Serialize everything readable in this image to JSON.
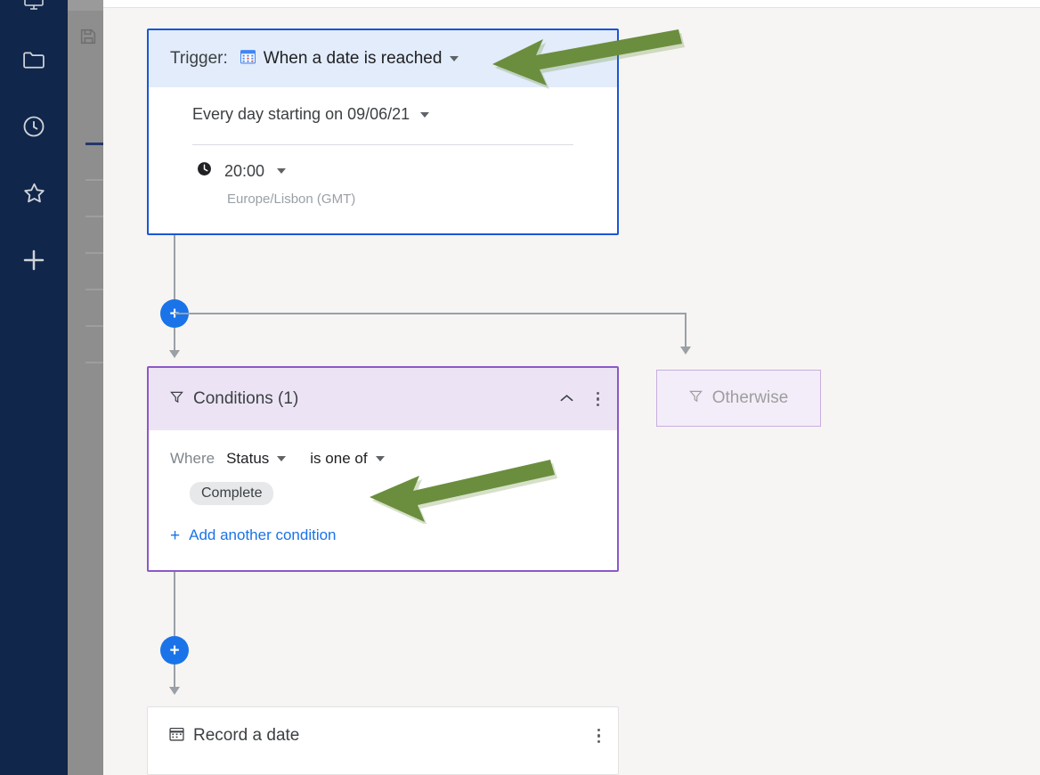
{
  "app": {
    "background_color": "#f6f5f3",
    "rail_color": "#10264a",
    "accent_blue": "#1a73e8",
    "annotation_color": "#6b8e3e"
  },
  "sidebar": {
    "items": [
      {
        "icon": "monitor-icon",
        "label": "Monitor"
      },
      {
        "icon": "folder-icon",
        "label": "Folder"
      },
      {
        "icon": "clock-icon",
        "label": "Recent"
      },
      {
        "icon": "star-icon",
        "label": "Favorites"
      },
      {
        "icon": "plus-icon",
        "label": "Add"
      }
    ]
  },
  "overlay_strip": {
    "save_icon": "save-icon",
    "row_count": 7
  },
  "trigger_card": {
    "label": "Trigger:",
    "icon": "calendar-grid-icon",
    "value": "When a date is reached",
    "caret_icon": "chevron-down-icon",
    "recurrence": "Every day starting on 09/06/21",
    "recurrence_caret_icon": "chevron-down-icon",
    "time_icon": "clock-icon",
    "time": "20:00",
    "time_caret_icon": "chevron-down-icon",
    "timezone": "Europe/Lisbon (GMT)",
    "border_color": "#1a56d6",
    "header_color": "#e2ecfa"
  },
  "conditions_card": {
    "filter_icon": "filter-icon",
    "title": "Conditions (1)",
    "collapse_icon": "chevron-up-icon",
    "menu_icon": "kebab-menu-icon",
    "where_label": "Where",
    "field": "Status",
    "field_caret_icon": "chevron-down-icon",
    "operator": "is one of",
    "operator_caret_icon": "chevron-down-icon",
    "values": [
      "Complete"
    ],
    "add_condition_label": "Add another condition",
    "add_condition_icon": "plus-icon",
    "border_color": "#8b59c6",
    "header_color": "#ece4f5"
  },
  "otherwise_box": {
    "icon": "filter-icon",
    "label": "Otherwise",
    "border_color": "#c8aee0",
    "background_color": "#f3edf9"
  },
  "record_card": {
    "icon": "calendar-icon",
    "title": "Record a date",
    "menu_icon": "kebab-menu-icon"
  },
  "flow_nodes": {
    "add_step_top_label": "+",
    "add_step_bottom_label": "+"
  },
  "annotations": [
    {
      "name": "arrow-to-trigger-dropdown",
      "color": "#6b8e3e"
    },
    {
      "name": "arrow-to-condition-value",
      "color": "#6b8e3e"
    }
  ]
}
